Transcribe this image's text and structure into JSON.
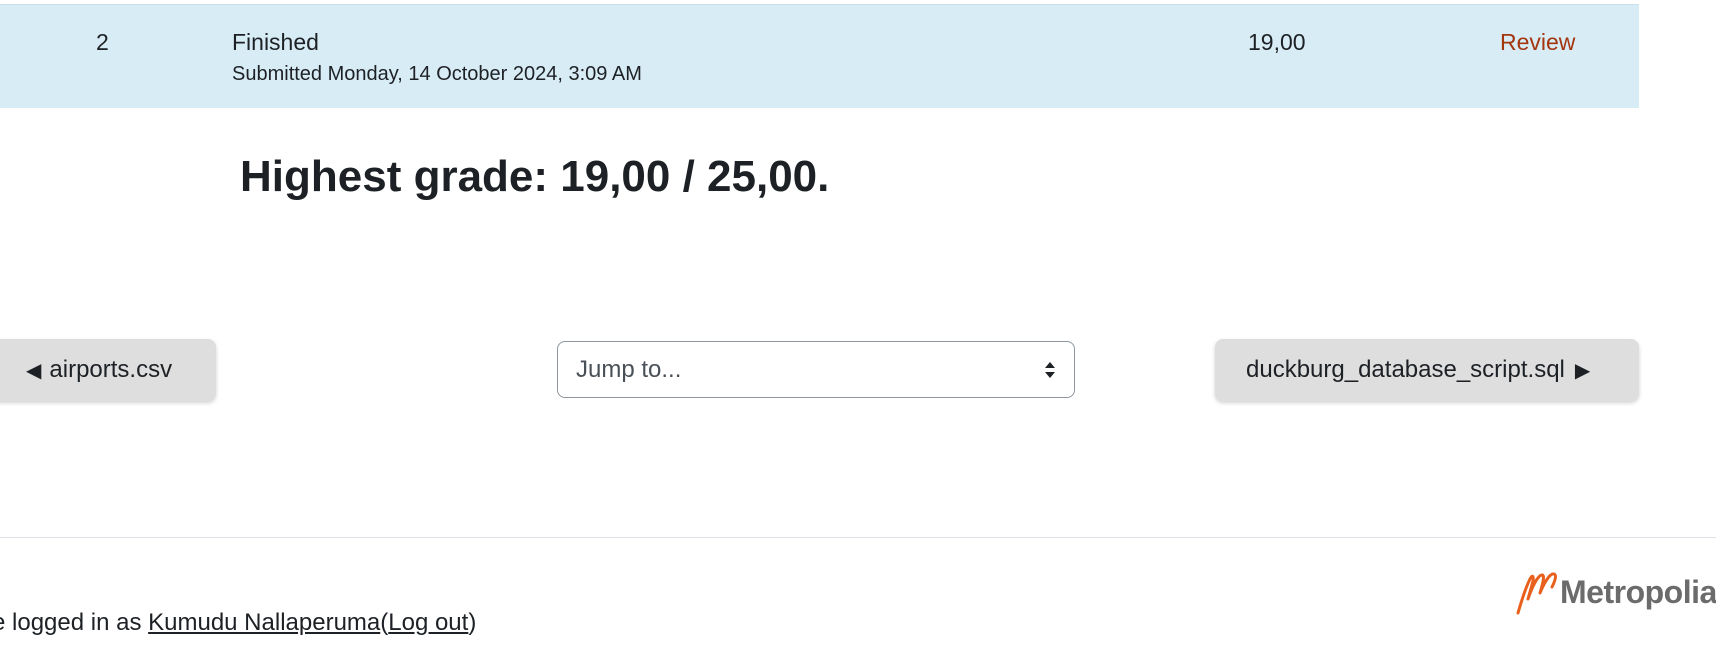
{
  "attempt": {
    "number": "2",
    "state": "Finished",
    "submitted": "Submitted Monday, 14 October 2024, 3:09 AM",
    "grade": "19,00",
    "review_label": "Review"
  },
  "summary": {
    "highest_grade": "Highest grade: 19,00 / 25,00."
  },
  "navigation": {
    "prev_label": "airports.csv",
    "prev_arrow": "◀",
    "jump_placeholder": "Jump to...",
    "next_label": "duckburg_database_script.sql",
    "next_arrow": "▶"
  },
  "footer": {
    "logged_in_prefix": "e logged in as ",
    "user_name": "Kumudu Nallaperuma",
    "open_paren": "(",
    "logout_label": "Log out",
    "close_paren": ")",
    "logo_text": "Metropolia",
    "logo_color": "#e8601c"
  },
  "colors": {
    "row_highlight": "#d8ecf5",
    "link": "#a3350f",
    "button_bg": "#dedede"
  },
  "icons": {
    "select_caret": "up-down-caret-icon",
    "logo_mark": "metropolia-logo-icon"
  }
}
